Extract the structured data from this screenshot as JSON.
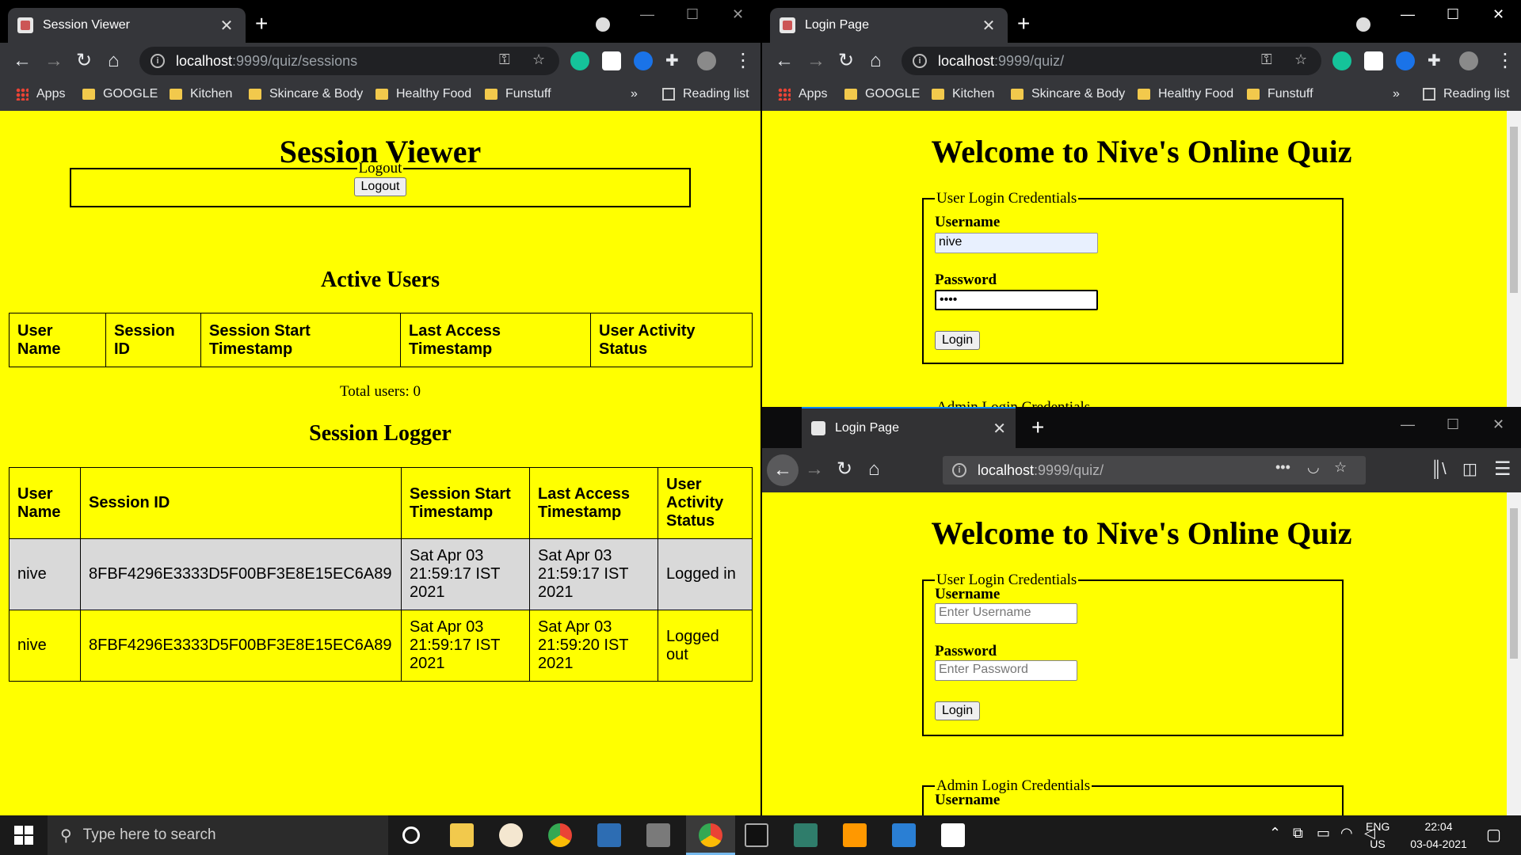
{
  "left_browser": {
    "tab_title": "Session Viewer",
    "url_host": "localhost",
    "url_rest": ":9999/quiz/sessions",
    "bookmarks": [
      "Apps",
      "GOOGLE",
      "Kitchen",
      "Skincare & Body",
      "Healthy Food",
      "Funstuff"
    ],
    "more": "»",
    "reading_list": "Reading list"
  },
  "session_viewer": {
    "title": "Session Viewer",
    "logout_legend": "Logout",
    "logout_button": "Logout",
    "active_users_heading": "Active Users",
    "active_headers": [
      "User Name",
      "Session ID",
      "Session Start Timestamp",
      "Last Access Timestamp",
      "User Activity Status"
    ],
    "total_users": "Total users: 0",
    "logger_heading": "Session Logger",
    "logger_headers": [
      "User Name",
      "Session ID",
      "Session Start Timestamp",
      "Last Access Timestamp",
      "User Activity Status"
    ],
    "logger_rows": [
      [
        "nive",
        "8FBF4296E3333D5F00BF3E8E15EC6A89",
        "Sat Apr 03 21:59:17 IST 2021",
        "Sat Apr 03 21:59:17 IST 2021",
        "Logged in"
      ],
      [
        "nive",
        "8FBF4296E3333D5F00BF3E8E15EC6A89",
        "Sat Apr 03 21:59:17 IST 2021",
        "Sat Apr 03 21:59:20 IST 2021",
        "Logged out"
      ]
    ]
  },
  "right_top_browser": {
    "tab_title": "Login Page",
    "url_host": "localhost",
    "url_rest": ":9999/quiz/",
    "bookmarks": [
      "Apps",
      "GOOGLE",
      "Kitchen",
      "Skincare & Body",
      "Healthy Food",
      "Funstuff"
    ],
    "more": "»",
    "reading_list": "Reading list"
  },
  "login_chrome": {
    "title": "Welcome to Nive's Online Quiz",
    "legend": "User Login Credentials",
    "username_label": "Username",
    "username_value": "nive",
    "password_label": "Password",
    "password_value": "••••",
    "login_button": "Login",
    "partial_next_legend": "Admin Login Credentials"
  },
  "firefox": {
    "tab_title": "Login Page",
    "url_host": "localhost",
    "url_rest": ":9999/quiz/"
  },
  "login_firefox": {
    "title": "Welcome to Nive's Online Quiz",
    "legend": "User Login Credentials",
    "username_label": "Username",
    "username_placeholder": "Enter Username",
    "password_label": "Password",
    "password_placeholder": "Enter Password",
    "login_button": "Login",
    "admin_legend": "Admin Login Credentials",
    "admin_username_label": "Username"
  },
  "taskbar": {
    "search_placeholder": "Type here to search",
    "lang": "ENG",
    "region": "US",
    "time": "22:04",
    "date": "03-04-2021"
  },
  "colors": {
    "page_bg": "#ffff00",
    "row_shade": "#d9d9d9"
  }
}
